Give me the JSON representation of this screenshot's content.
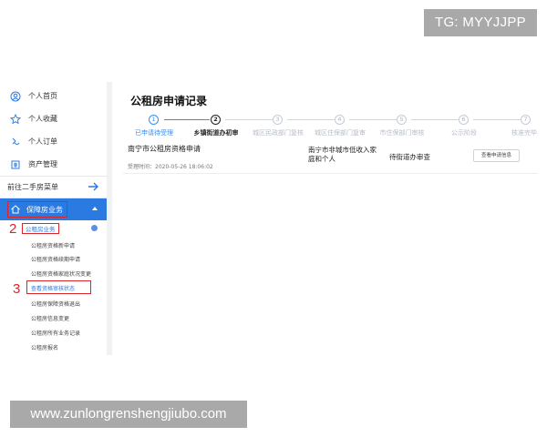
{
  "watermarks": {
    "top": "TG: MYYJJPP",
    "bottom": "www.zunlongrenshengjiubo.com"
  },
  "sidebar": {
    "items": [
      {
        "label": "个人首页",
        "icon": "user-circle-icon"
      },
      {
        "label": "个人收藏",
        "icon": "star-icon"
      },
      {
        "label": "个人订单",
        "icon": "order-icon"
      },
      {
        "label": "资产管理",
        "icon": "asset-icon"
      }
    ],
    "prev_link": "前往二手房菜单",
    "active_section": "保障房业务",
    "sub_header": "公租房业务",
    "sub_items": [
      "公租房资格新申请",
      "公租房资格续期申请",
      "公租房资格家庭状况变更",
      "查看资格审核状态",
      "公租房保障资格退出",
      "公租房信息变更",
      "公租房所有业务记录",
      "公租房报名"
    ],
    "annotations": [
      "2",
      "3"
    ]
  },
  "main": {
    "title": "公租房申请记录",
    "steps": [
      {
        "num": "1",
        "label": "已申请待受理",
        "state": "done"
      },
      {
        "num": "2",
        "label": "乡镇街道办初审",
        "state": "current"
      },
      {
        "num": "3",
        "label": "城区民政部门复核",
        "state": "todo"
      },
      {
        "num": "4",
        "label": "城区住保部门复审",
        "state": "todo"
      },
      {
        "num": "5",
        "label": "市住保部门审核",
        "state": "todo"
      },
      {
        "num": "6",
        "label": "公示阶段",
        "state": "todo"
      },
      {
        "num": "7",
        "label": "核准完毕",
        "state": "todo"
      }
    ],
    "record": {
      "title": "南宁市公租房资格申请",
      "time": "受理时间：2020-05-26 18:06:02",
      "type": "南宁市非城市低收入家庭和个人",
      "status": "待街道办审查",
      "button": "查看申请信息"
    }
  },
  "colors": {
    "accent": "#2a7ae2",
    "highlight": "#d9262b",
    "background": "#f1f2f4"
  }
}
